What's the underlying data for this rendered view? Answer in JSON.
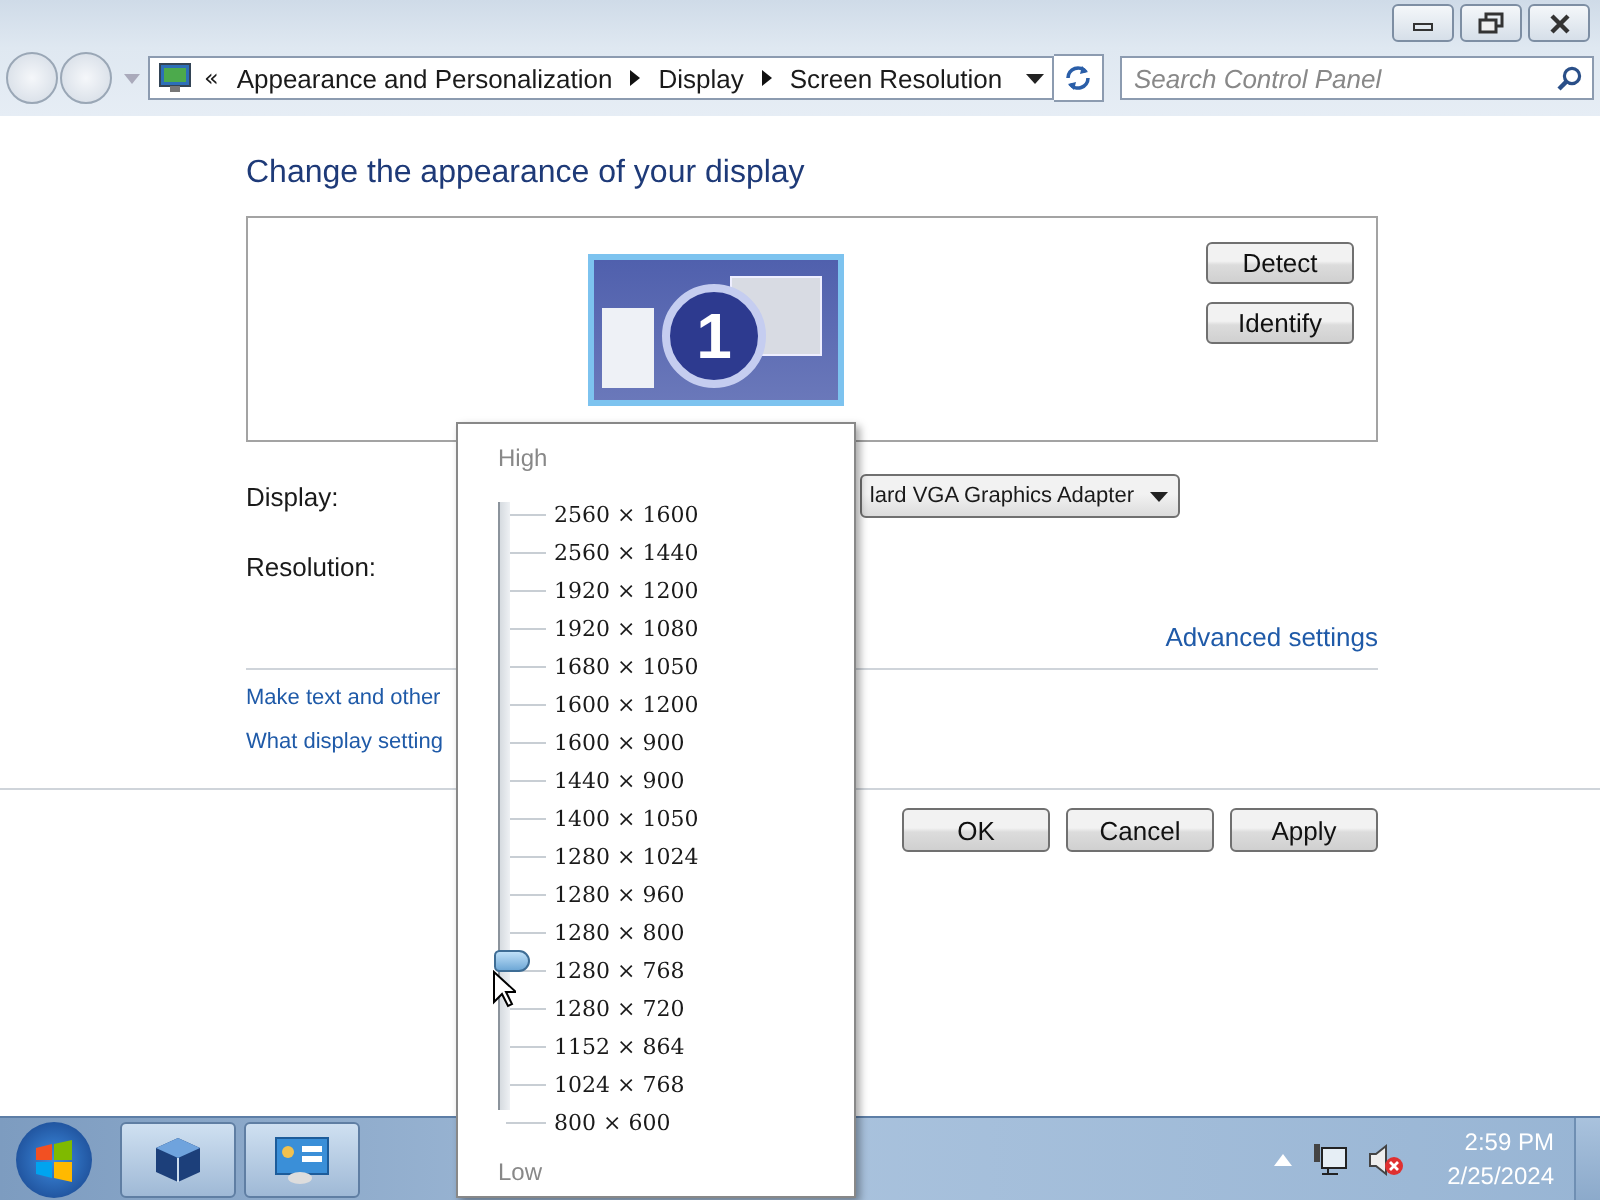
{
  "address_bar": {
    "overflow": "«",
    "breadcrumbs": [
      "Appearance and Personalization",
      "Display",
      "Screen Resolution"
    ]
  },
  "search": {
    "placeholder": "Search Control Panel"
  },
  "heading": "Change the appearance of your display",
  "monitor": {
    "number": "1"
  },
  "side_buttons": [
    "Detect",
    "Identify"
  ],
  "display": {
    "label": "Display:",
    "value": "lard VGA Graphics Adapter"
  },
  "resolution": {
    "label": "Resolution:"
  },
  "advanced_link": "Advanced settings",
  "links": [
    "Make text and other",
    "What display setting"
  ],
  "dialog_buttons": [
    "OK",
    "Cancel",
    "Apply"
  ],
  "resolution_popup": {
    "high": "High",
    "low": "Low",
    "level": 0.25,
    "options": [
      "2560 × 1600",
      "2560 × 1440",
      "1920 × 1200",
      "1920 × 1080",
      "1680 × 1050",
      "1600 × 1200",
      "1600 × 900",
      "1440 × 900",
      "1400 × 1050",
      "1280 × 1024",
      "1280 × 960",
      "1280 × 800",
      "1280 × 768",
      "1280 × 720",
      "1152 × 864",
      "1024 × 768",
      "800 × 600"
    ]
  },
  "taskbar": {
    "time": "2:59 PM",
    "date": "2/25/2024"
  }
}
